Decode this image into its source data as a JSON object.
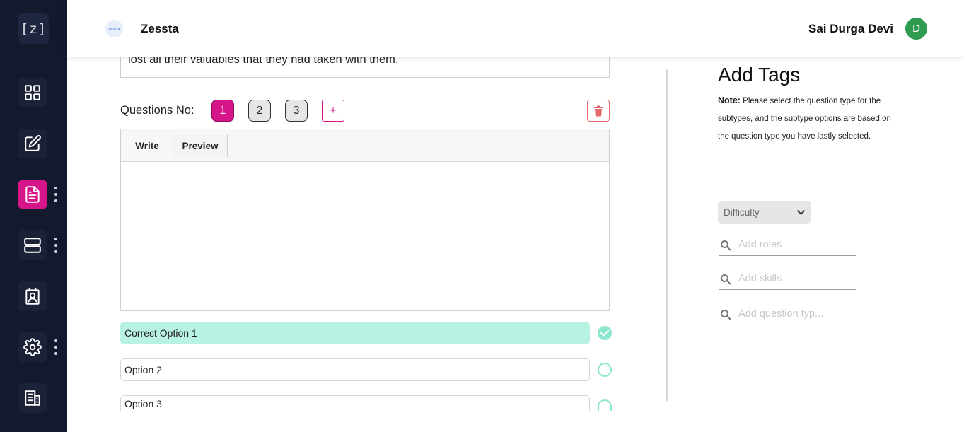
{
  "sidebar": {
    "logo": "[z]",
    "items": [
      {
        "icon": "dashboard-grid-icon",
        "active": false,
        "has_menu": false
      },
      {
        "icon": "edit-icon",
        "active": false,
        "has_menu": false
      },
      {
        "icon": "document-icon",
        "active": true,
        "has_menu": true
      },
      {
        "icon": "server-icon",
        "active": false,
        "has_menu": true
      },
      {
        "icon": "id-badge-icon",
        "active": false,
        "has_menu": false
      },
      {
        "icon": "settings-icon",
        "active": false,
        "has_menu": true
      },
      {
        "icon": "building-icon",
        "active": false,
        "has_menu": false
      }
    ],
    "accent_color": "#d6158a"
  },
  "header": {
    "brand_logo_text": "zessta",
    "brand_name": "Zessta",
    "user_name": "Sai Durga Devi",
    "user_initial": "D"
  },
  "passage": {
    "visible_text": "lost all their valuables that they had taken with them."
  },
  "questions": {
    "label": "Questions No:",
    "numbers": [
      "1",
      "2",
      "3"
    ],
    "active": "1",
    "add_label": "+"
  },
  "editor": {
    "tab_write": "Write",
    "tab_preview": "Preview"
  },
  "options": [
    {
      "label": "Correct Option 1",
      "correct": true
    },
    {
      "label": "Option 2",
      "correct": false
    },
    {
      "label": "Option 3",
      "correct": false
    }
  ],
  "tags": {
    "title": "Add Tags",
    "note_label": "Note:",
    "note_text": "Please select the question type for the subtypes, and the subtype options are based on the question type you have lastly selected.",
    "difficulty_label": "Difficulty",
    "roles_placeholder": "Add roles",
    "skills_placeholder": "Add skills",
    "question_type_placeholder": "Add question typ..."
  }
}
